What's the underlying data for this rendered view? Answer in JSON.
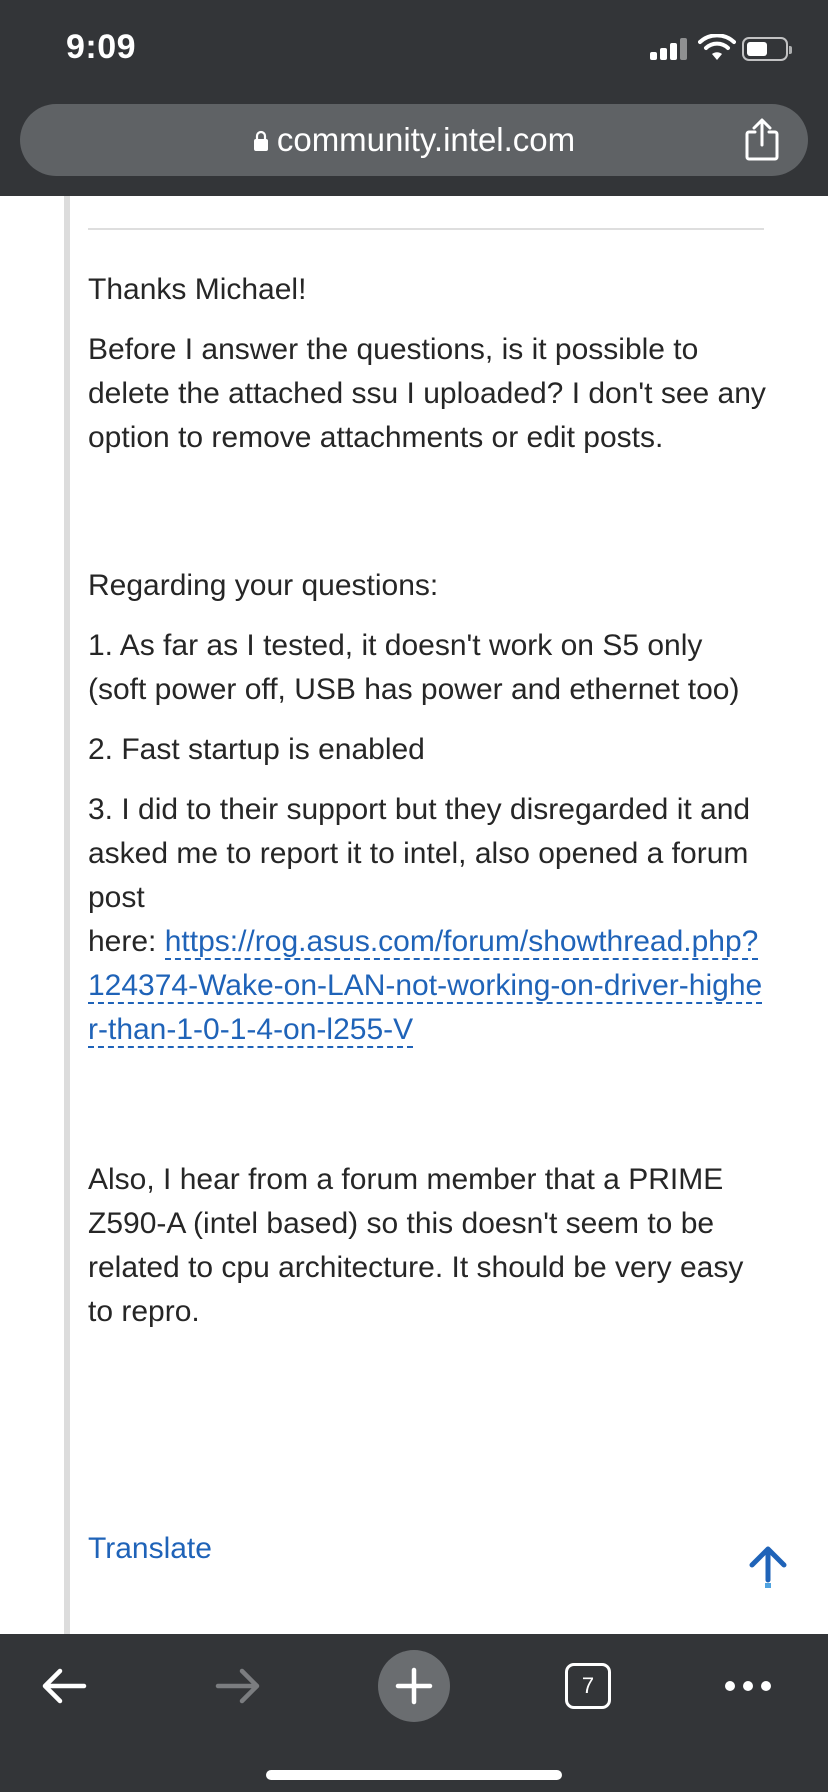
{
  "status_bar": {
    "time": "9:09"
  },
  "browser": {
    "url": "community.intel.com",
    "open_tab_count": "7"
  },
  "post": {
    "greeting": "Thanks Michael!",
    "paragraph1": "Before I answer the questions, is it possible to delete the attached ssu I uploaded? I don't see any option to remove attachments or edit posts.",
    "questions_intro": "Regarding your questions:",
    "item1": "1.  As far as I tested, it doesn't work on S5 only (soft power off, USB has power and ethernet too)",
    "item2": "2. Fast startup is enabled",
    "item3": "3. I did to their support but they disregarded it and asked me to report it to intel, also opened a forum post",
    "item3_here": "here: ",
    "link_text": "https://rog.asus.com/forum/showthread.php?124374-Wake-on-LAN-not-working-on-driver-higher-than-1-0-1-4-on-l255-V",
    "closing": "Also, I hear from a forum member that a PRIME Z590-A (intel based)  so this doesn't seem to be related to cpu architecture. It should be very easy to repro."
  },
  "actions": {
    "translate_label": "Translate"
  },
  "colors": {
    "chrome_background": "#333538",
    "url_bar_background": "#5f6265",
    "link": "#1f63b8",
    "body_text": "#262626"
  },
  "icons": {
    "lock": "lock-icon",
    "share": "share-icon",
    "scroll_top": "arrow-up-icon",
    "back": "arrow-left-icon",
    "forward": "arrow-right-icon",
    "new_tab": "plus-icon",
    "tabs": "tabs-icon",
    "more": "more-dots-icon"
  }
}
